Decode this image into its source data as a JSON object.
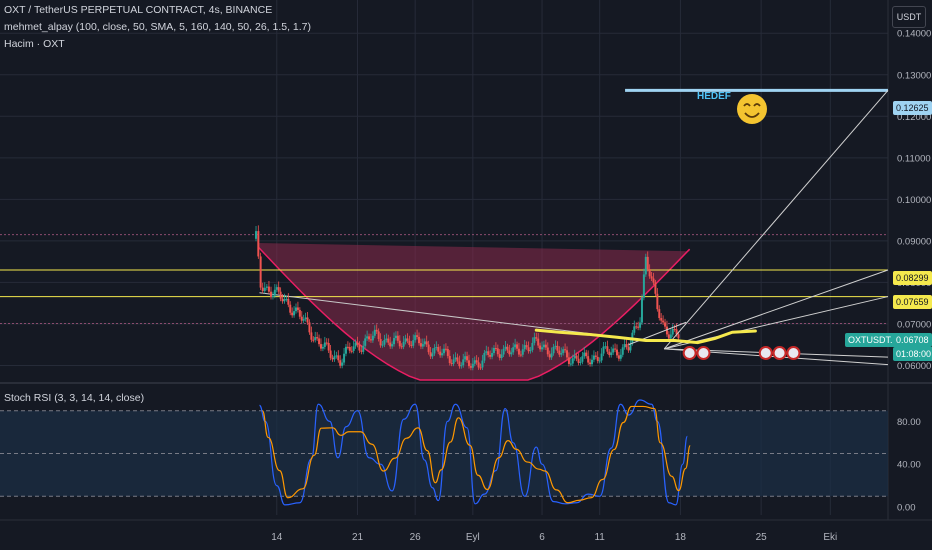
{
  "header": {
    "title": "OXT / TetherUS PERPETUAL CONTRACT, 4s, BINANCE",
    "indicator": "mehmet_alpay (100, close, 50, SMA, 5, 160, 140, 50, 26, 1.5, 1.7)",
    "volume": "Hacim · OXT"
  },
  "unit_button": "USDT",
  "annotations": {
    "target_label": "HEDEF",
    "symbol_tag": "OXTUSDT.P",
    "price_tags": [
      {
        "value": "0.12625",
        "color": "#9fd3f2",
        "text_color": "#131722"
      },
      {
        "value": "0.08299",
        "color": "#f5e94d",
        "text_color": "#131722"
      },
      {
        "value": "0.07659",
        "color": "#f5e94d",
        "text_color": "#131722"
      },
      {
        "value": "0.06708",
        "color": "#26a69a",
        "text_color": "#ffffff"
      },
      {
        "value": "01:08:00",
        "color": "#26a69a",
        "text_color": "#ffffff"
      }
    ]
  },
  "rsi": {
    "title": "Stoch RSI (3, 3, 14, 14, close)"
  },
  "colors": {
    "bg": "#151923",
    "grid": "#262b38",
    "up": "#26a69a",
    "down": "#ef5350",
    "yellow": "#f5e94d",
    "target": "#9fd3f2",
    "rsi_k": "#2962ff",
    "rsi_d": "#ff9800",
    "band": "#1b2f46"
  },
  "chart_data": [
    {
      "type": "candlestick",
      "title": "OXT / TetherUS PERPETUAL CONTRACT, 4s, BINANCE",
      "y_ticks": [
        0.06,
        0.07,
        0.08,
        0.09,
        0.1,
        0.11,
        0.12,
        0.13,
        0.14
      ],
      "y_tick_labels": [
        "0.06000",
        "0.07000",
        "0.08000",
        "0.09000",
        "0.10000",
        "0.11000",
        "0.12000",
        "0.13000",
        "0.14000"
      ],
      "ylim": [
        0.0565,
        0.148
      ],
      "x_ticks": [
        {
          "day": 14,
          "label": "14"
        },
        {
          "day": 21,
          "label": "21"
        },
        {
          "day": 26,
          "label": "26"
        },
        {
          "day": 31,
          "label": "Eyl"
        },
        {
          "day": 37,
          "label": "6"
        },
        {
          "day": 42,
          "label": "11"
        },
        {
          "day": 49,
          "label": "18"
        },
        {
          "day": 56,
          "label": "25"
        },
        {
          "day": 62,
          "label": "Eki"
        }
      ],
      "xlim": [
        -10,
        67
      ],
      "horizontal_levels": [
        {
          "value": 0.12625,
          "style": "target"
        },
        {
          "value": 0.08299,
          "style": "yellow"
        },
        {
          "value": 0.07659,
          "style": "yellow"
        },
        {
          "value": 0.0915,
          "style": "dotted"
        },
        {
          "value": 0.0701,
          "style": "dotted"
        }
      ],
      "close_path": [
        [
          12.2,
          0.0905
        ],
        [
          12.6,
          0.0795
        ],
        [
          13.5,
          0.078
        ],
        [
          14.5,
          0.076
        ],
        [
          15.5,
          0.0735
        ],
        [
          16.5,
          0.07
        ],
        [
          17.5,
          0.066
        ],
        [
          18.5,
          0.063
        ],
        [
          19.5,
          0.0615
        ],
        [
          20.5,
          0.064
        ],
        [
          21.5,
          0.0655
        ],
        [
          22.5,
          0.067
        ],
        [
          23.5,
          0.066
        ],
        [
          24.5,
          0.065
        ],
        [
          25.5,
          0.0665
        ],
        [
          26.5,
          0.065
        ],
        [
          27.5,
          0.064
        ],
        [
          28.5,
          0.0625
        ],
        [
          29.5,
          0.0615
        ],
        [
          30.5,
          0.06
        ],
        [
          31.5,
          0.061
        ],
        [
          32.5,
          0.0625
        ],
        [
          33.5,
          0.064
        ],
        [
          34.5,
          0.063
        ],
        [
          35.5,
          0.0645
        ],
        [
          36.5,
          0.065
        ],
        [
          37.5,
          0.064
        ],
        [
          38.5,
          0.063
        ],
        [
          39.5,
          0.062
        ],
        [
          40.5,
          0.061
        ],
        [
          41.5,
          0.062
        ],
        [
          42.5,
          0.063
        ],
        [
          43.5,
          0.0635
        ],
        [
          44.5,
          0.064
        ],
        [
          45.5,
          0.072
        ],
        [
          46.0,
          0.086
        ],
        [
          46.5,
          0.08
        ],
        [
          47.0,
          0.074
        ],
        [
          47.5,
          0.07
        ],
        [
          48.0,
          0.068
        ],
        [
          48.5,
          0.067
        ],
        [
          49.0,
          0.0671
        ]
      ],
      "stoch_rsi": {
        "ylim": [
          0,
          100
        ],
        "y_ticks": [
          0,
          40,
          80
        ],
        "y_tick_labels": [
          "0.00",
          "40.00",
          "80.00"
        ],
        "bands": [
          10,
          90
        ],
        "midline": 50,
        "k_points": [
          [
            12.5,
            95
          ],
          [
            13.0,
            80
          ],
          [
            14.0,
            20
          ],
          [
            14.7,
            2
          ],
          [
            16.0,
            4
          ],
          [
            17.0,
            45
          ],
          [
            17.6,
            96
          ],
          [
            18.6,
            80
          ],
          [
            19.3,
            46
          ],
          [
            20.0,
            75
          ],
          [
            21.0,
            90
          ],
          [
            22.0,
            46
          ],
          [
            23.0,
            40
          ],
          [
            24.0,
            15
          ],
          [
            25.0,
            82
          ],
          [
            26.0,
            96
          ],
          [
            26.8,
            44
          ],
          [
            27.5,
            18
          ],
          [
            28.0,
            6
          ],
          [
            28.8,
            80
          ],
          [
            29.5,
            96
          ],
          [
            30.5,
            74
          ],
          [
            31.2,
            3
          ],
          [
            32.0,
            12
          ],
          [
            33.0,
            34
          ],
          [
            33.8,
            92
          ],
          [
            34.5,
            60
          ],
          [
            35.5,
            10
          ],
          [
            36.5,
            56
          ],
          [
            37.0,
            40
          ],
          [
            38.0,
            5
          ],
          [
            39.0,
            3
          ],
          [
            40.0,
            4
          ],
          [
            41.0,
            12
          ],
          [
            42.0,
            10
          ],
          [
            43.0,
            55
          ],
          [
            43.8,
            96
          ],
          [
            44.5,
            86
          ],
          [
            45.5,
            100
          ],
          [
            46.5,
            96
          ],
          [
            47.0,
            80
          ],
          [
            48.0,
            4
          ],
          [
            48.6,
            2
          ],
          [
            49.2,
            40
          ],
          [
            49.6,
            66
          ]
        ]
      }
    }
  ]
}
